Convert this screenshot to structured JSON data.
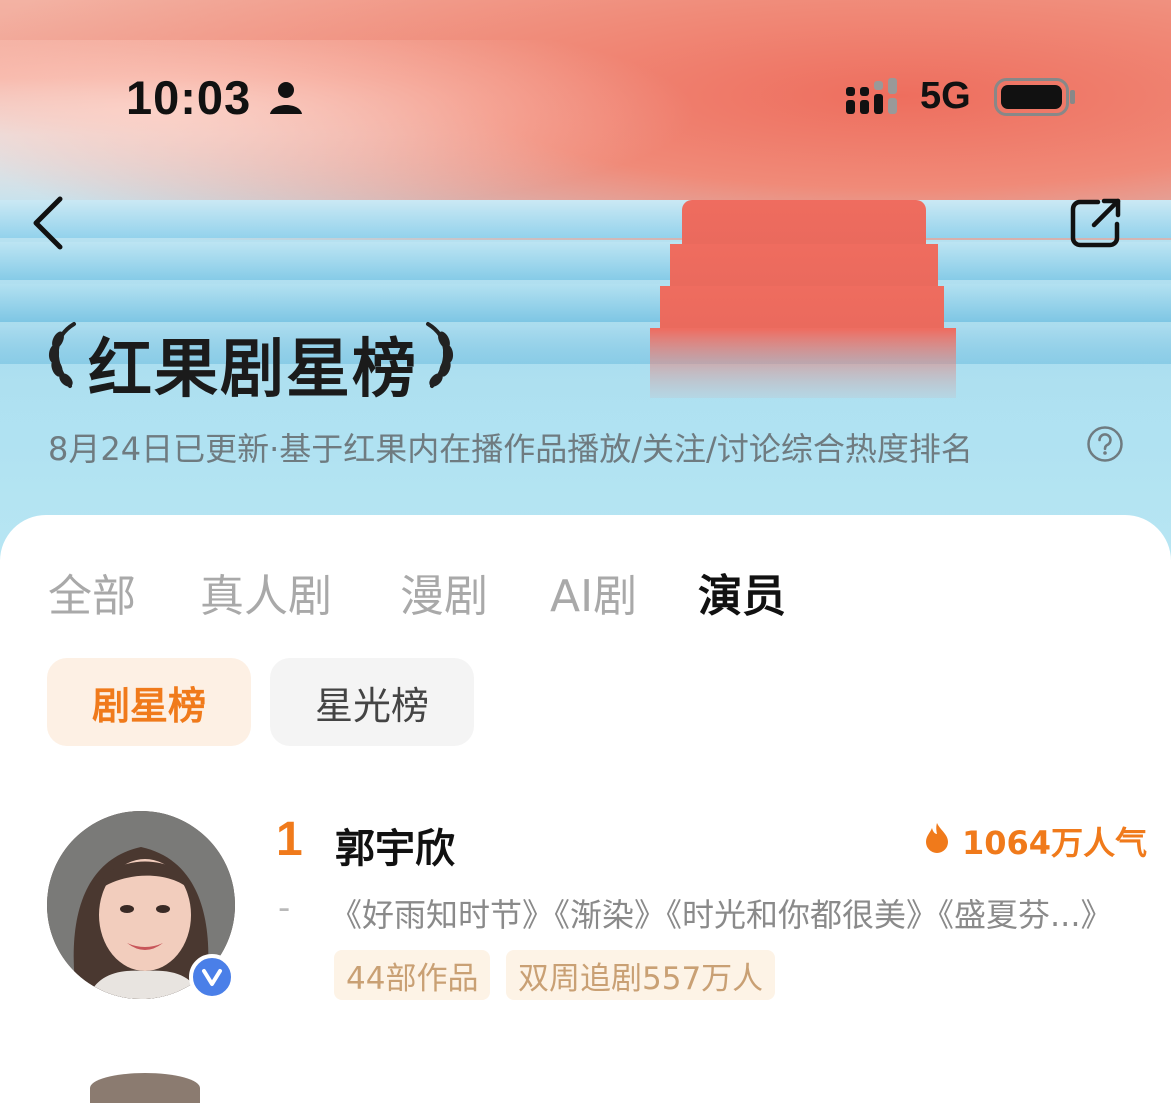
{
  "status_bar": {
    "time": "10:03",
    "network": "5G"
  },
  "header": {
    "title": "红果剧星榜",
    "subtitle": "8月24日已更新·基于红果内在播作品播放/关注/讨论综合热度排名"
  },
  "icons": {
    "back": "chevron-left-icon",
    "share": "share-icon",
    "help": "help-icon",
    "fire": "fire-icon",
    "verified": "verified-icon"
  },
  "tabs": [
    {
      "label": "全部",
      "active": false
    },
    {
      "label": "真人剧",
      "active": false
    },
    {
      "label": "漫剧",
      "active": false
    },
    {
      "label": "AI剧",
      "active": false
    },
    {
      "label": "演员",
      "active": true
    }
  ],
  "sub_tabs": [
    {
      "label": "剧星榜",
      "active": true
    },
    {
      "label": "星光榜",
      "active": false
    }
  ],
  "ranking": [
    {
      "rank": "1",
      "name": "郭宇欣",
      "popularity": "1064万人气",
      "trend": "-",
      "works": "《好雨知时节》《渐染》《时光和你都很美》《盛夏芬...》",
      "tags": [
        "44部作品",
        "双周追剧557万人"
      ]
    }
  ],
  "colors": {
    "accent": "#f07a1b",
    "chip_active_bg": "#fdf0e4",
    "tag_bg": "#fdf3e6",
    "tag_text": "#c9a074",
    "verified": "#4a7fe8"
  }
}
